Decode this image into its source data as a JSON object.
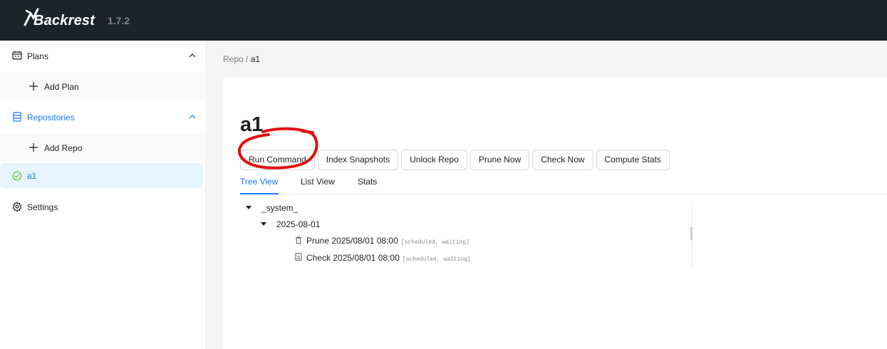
{
  "header": {
    "app_name": "Backrest",
    "version": "1.7.2"
  },
  "sidebar": {
    "plans_label": "Plans",
    "add_plan_label": "Add Plan",
    "repositories_label": "Repositories",
    "add_repo_label": "Add Repo",
    "repo_item_label": "a1",
    "settings_label": "Settings"
  },
  "breadcrumb": {
    "root": "Repo",
    "separator": "/",
    "current": "a1"
  },
  "repo": {
    "title": "a1"
  },
  "actions": {
    "run_command": "Run Command",
    "index_snapshots": "Index Snapshots",
    "unlock_repo": "Unlock Repo",
    "prune_now": "Prune Now",
    "check_now": "Check Now",
    "compute_stats": "Compute Stats"
  },
  "tabs": {
    "tree_view": "Tree View",
    "list_view": "List View",
    "stats": "Stats"
  },
  "tree": {
    "root_label": "_system_",
    "date_label": "2025-08-01",
    "ops": [
      {
        "label": "Prune 2025/08/01 08:00",
        "status": "[scheduled, waiting]"
      },
      {
        "label": "Check 2025/08/01 08:00",
        "status": "[scheduled, waiting]"
      }
    ]
  },
  "colors": {
    "header_bg": "#1d232b",
    "accent": "#1677ff",
    "annotation": "#e01010"
  }
}
